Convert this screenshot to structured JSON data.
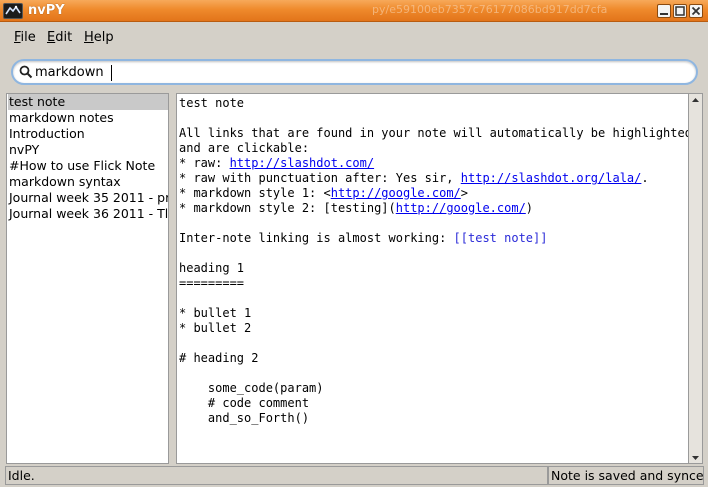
{
  "window": {
    "title": "nvPY",
    "ghost_text": "py/e59100eb7357c76177086bd917dd7cfa"
  },
  "menu": {
    "file": {
      "accel": "F",
      "rest": "ile"
    },
    "edit": {
      "accel": "E",
      "rest": "dit"
    },
    "help": {
      "accel": "H",
      "rest": "elp"
    }
  },
  "search": {
    "value": "markdown"
  },
  "notes": [
    {
      "label": "test note",
      "selected": true
    },
    {
      "label": "markdown notes",
      "selected": false
    },
    {
      "label": "Introduction",
      "selected": false
    },
    {
      "label": "nvPY",
      "selected": false
    },
    {
      "label": "#How to use Flick Note",
      "selected": false
    },
    {
      "label": "markdown syntax",
      "selected": false
    },
    {
      "label": "Journal week 35 2011 - pre",
      "selected": false
    },
    {
      "label": "Journal week 36 2011 - Tl",
      "selected": false
    }
  ],
  "editor": {
    "l1": "test note",
    "l3": "All links that are found in your note will automatically be highlighted",
    "l4": "and are clickable:",
    "l5_pre": "* raw: ",
    "l5_link": "http://slashdot.com/",
    "l6_pre": "* raw with punctuation after: Yes sir, ",
    "l6_link": "http://slashdot.org/lala/",
    "l6_post": ".",
    "l7_pre": "* markdown style 1: <",
    "l7_link": "http://google.com/",
    "l7_post": ">",
    "l8_pre": "* markdown style 2: [testing](",
    "l8_link": "http://google.com/",
    "l8_post": ")",
    "l10_pre": "Inter-note linking is almost working: ",
    "l10_link": "[[test note]]",
    "l12": "heading 1",
    "l13": "=========",
    "l15": "* bullet 1",
    "l16": "* bullet 2",
    "l18": "# heading 2",
    "l20": "    some_code(param)",
    "l21": "    # code comment",
    "l22": "    and_so_Forth()"
  },
  "status": {
    "left": "Idle.",
    "right": "Note is saved and synced"
  }
}
